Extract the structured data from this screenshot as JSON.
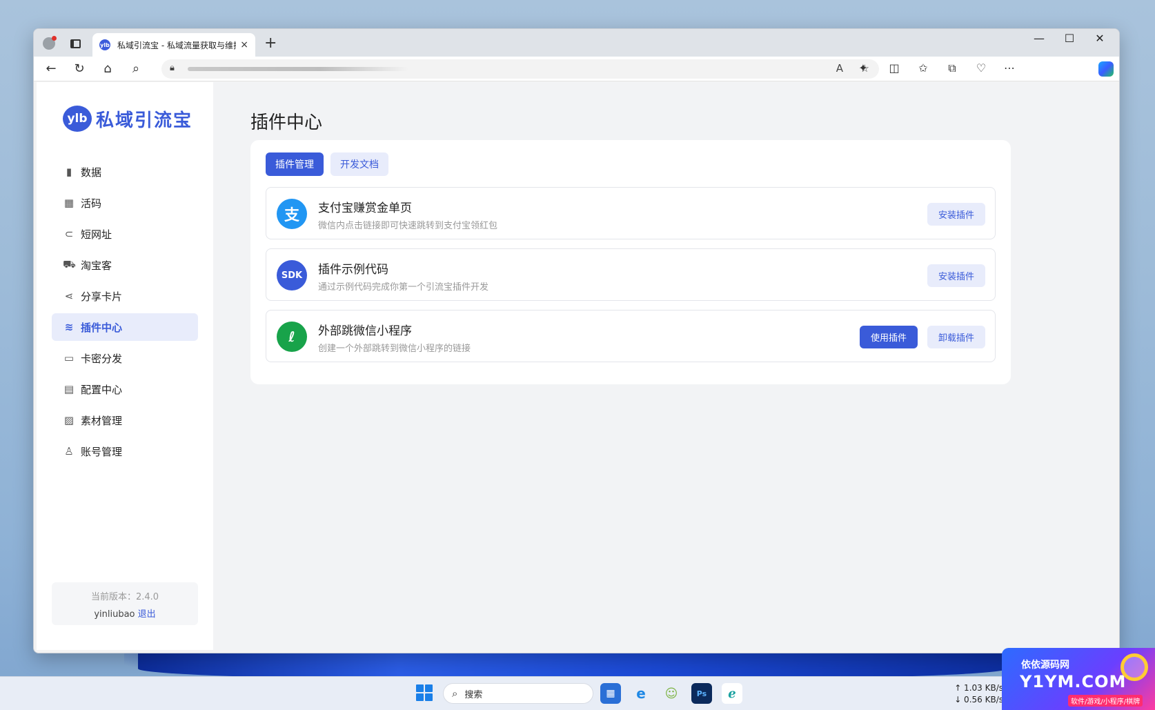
{
  "browser": {
    "tab_title": "私域引流宝 - 私域流量获取与维护",
    "tab_favicon_text": "ylb",
    "new_tab": "+",
    "close_tab": "×",
    "win_minimize": "—",
    "win_maximize": "☐",
    "win_close": "✕"
  },
  "sidebar": {
    "logo_badge": "ylb",
    "logo_text": "私域引流宝",
    "items": [
      {
        "label": "数据",
        "icon": "bar-chart-icon",
        "glyph": "▮"
      },
      {
        "label": "活码",
        "icon": "qr-code-icon",
        "glyph": "▦"
      },
      {
        "label": "短网址",
        "icon": "link-icon",
        "glyph": "⊂"
      },
      {
        "label": "淘宝客",
        "icon": "cart-icon",
        "glyph": "⛟"
      },
      {
        "label": "分享卡片",
        "icon": "share-icon",
        "glyph": "⋖"
      },
      {
        "label": "插件中心",
        "icon": "layers-icon",
        "glyph": "≋",
        "active": true
      },
      {
        "label": "卡密分发",
        "icon": "folder-icon",
        "glyph": "▭"
      },
      {
        "label": "配置中心",
        "icon": "settings-window-icon",
        "glyph": "▤"
      },
      {
        "label": "素材管理",
        "icon": "image-icon",
        "glyph": "▨"
      },
      {
        "label": "账号管理",
        "icon": "user-icon",
        "glyph": "♙"
      }
    ],
    "version": "当前版本：2.4.0",
    "username": "yinliubao",
    "logout": "退出"
  },
  "main": {
    "page_title": "插件中心",
    "tabs": [
      {
        "label": "插件管理",
        "active": true
      },
      {
        "label": "开发文档",
        "active": false
      }
    ],
    "plugins": [
      {
        "name": "支付宝赚赏金单页",
        "desc": "微信内点击链接即可快速跳转到支付宝领红包",
        "logo": "支",
        "buttons": [
          "安装插件"
        ]
      },
      {
        "name": "插件示例代码",
        "desc": "通过示例代码完成你第一个引流宝插件开发",
        "logo": "SDK",
        "buttons": [
          "安装插件"
        ]
      },
      {
        "name": "外部跳微信小程序",
        "desc": "创建一个外部跳转到微信小程序的链接",
        "logo": "ℓ",
        "buttons": [
          "使用插件",
          "卸载插件"
        ]
      }
    ]
  },
  "taskbar": {
    "search_placeholder": "搜索",
    "net_up": "↑ 1.03 KB/s",
    "net_down": "↓ 0.56 KB/s"
  },
  "watermark": {
    "top": "依依源码网",
    "main": "Y1YM.COM",
    "sub": "软件/游戏/小程序/棋牌"
  },
  "colors": {
    "accent": "#3a5bd9",
    "accent_soft": "#e8ecfb",
    "page_bg": "#f2f3f5"
  }
}
